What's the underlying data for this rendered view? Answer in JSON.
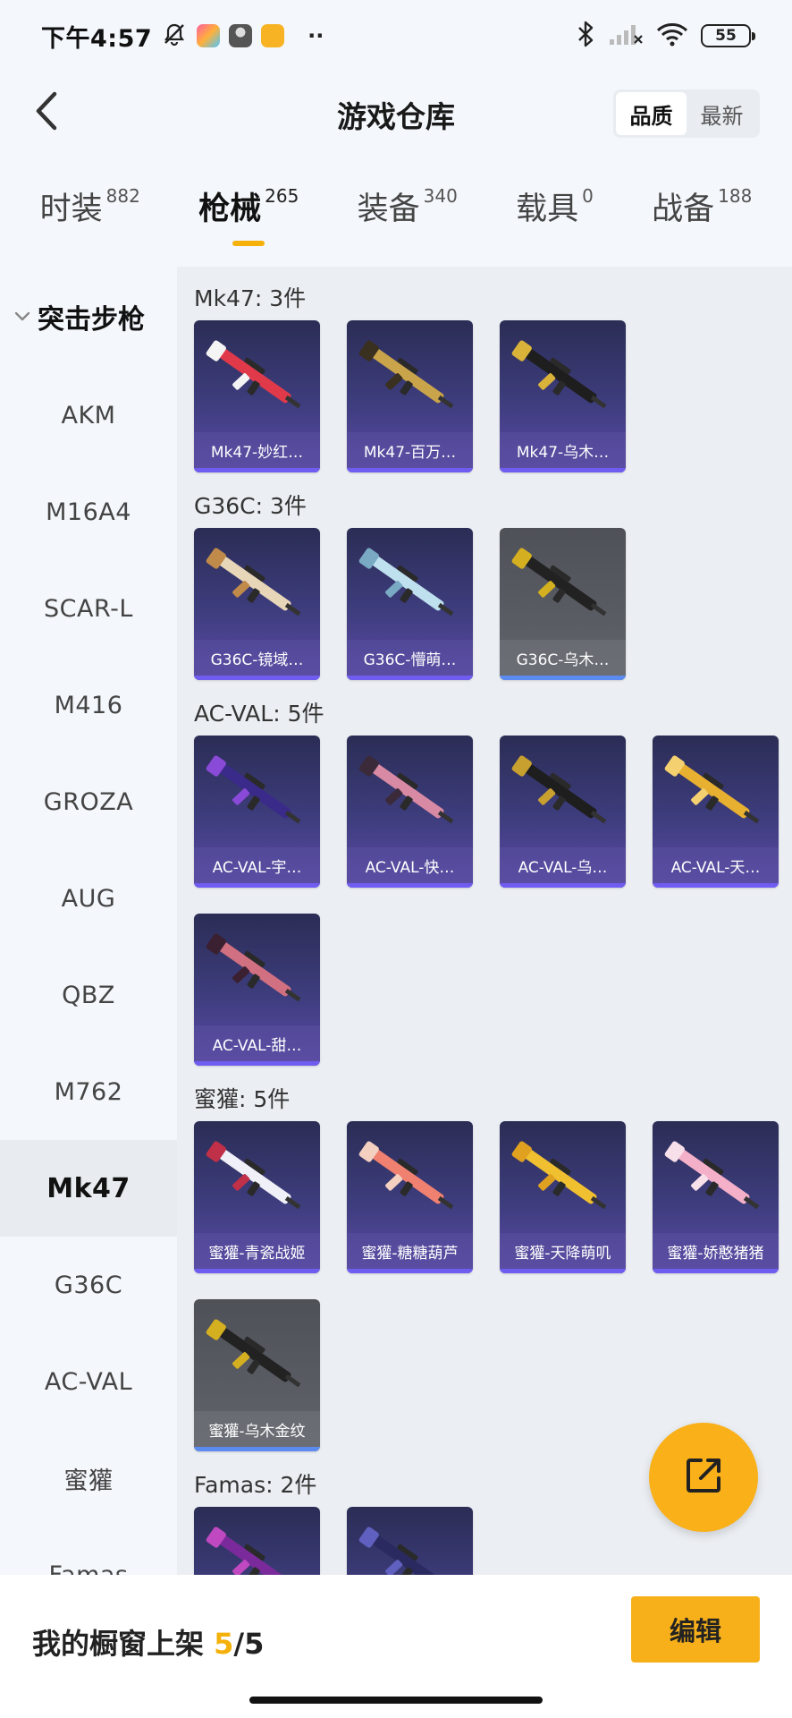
{
  "status_bar": {
    "time": "下午4:57",
    "battery": "55",
    "icons": [
      "mute-bell-icon",
      "game-app-icon",
      "avatar-app-icon",
      "note-app-icon",
      "more-dots-icon",
      "bluetooth-icon",
      "signal-icon",
      "wifi-icon",
      "battery-icon"
    ]
  },
  "header": {
    "title": "游戏仓库",
    "sort_options": [
      "品质",
      "最新"
    ],
    "active_sort": "品质"
  },
  "tabs": [
    {
      "label": "时装",
      "count": "882"
    },
    {
      "label": "枪械",
      "count": "265"
    },
    {
      "label": "装备",
      "count": "340"
    },
    {
      "label": "载具",
      "count": "0"
    },
    {
      "label": "战备",
      "count": "188"
    }
  ],
  "active_tab": "枪械",
  "sidebar": {
    "group": "突击步枪",
    "items": [
      "AKM",
      "M16A4",
      "SCAR-L",
      "M416",
      "GROZA",
      "AUG",
      "QBZ",
      "M762",
      "Mk47",
      "G36C",
      "AC-VAL",
      "蜜獾",
      "Famas"
    ],
    "active": "Mk47"
  },
  "sections": [
    {
      "title": "Mk47: 3件",
      "items": [
        {
          "name": "Mk47-妙红…",
          "grade": "purple"
        },
        {
          "name": "Mk47-百万…",
          "grade": "purple"
        },
        {
          "name": "Mk47-乌木…",
          "grade": "purple"
        }
      ]
    },
    {
      "title": "G36C: 3件",
      "items": [
        {
          "name": "G36C-镜域…",
          "grade": "purple"
        },
        {
          "name": "G36C-懵萌…",
          "grade": "purple"
        },
        {
          "name": "G36C-乌木…",
          "grade": "grey"
        }
      ]
    },
    {
      "title": "AC-VAL: 5件",
      "items": [
        {
          "name": "AC-VAL-宇…",
          "grade": "purple"
        },
        {
          "name": "AC-VAL-快…",
          "grade": "purple"
        },
        {
          "name": "AC-VAL-乌…",
          "grade": "purple"
        },
        {
          "name": "AC-VAL-天…",
          "grade": "purple"
        },
        {
          "name": "AC-VAL-甜…",
          "grade": "purple"
        }
      ]
    },
    {
      "title": "蜜獾: 5件",
      "items": [
        {
          "name": "蜜獾-青瓷战姬",
          "grade": "purple"
        },
        {
          "name": "蜜獾-糖糖葫芦",
          "grade": "purple"
        },
        {
          "name": "蜜獾-天降萌叽",
          "grade": "purple"
        },
        {
          "name": "蜜獾-娇憨猪猪",
          "grade": "purple"
        },
        {
          "name": "蜜獾-乌木金纹",
          "grade": "grey"
        }
      ]
    },
    {
      "title": "Famas: 2件",
      "items": [
        {
          "name": "",
          "grade": "purple"
        },
        {
          "name": "",
          "grade": "purple"
        }
      ]
    }
  ],
  "footer": {
    "shelf_label": "我的橱窗上架",
    "shelf_count": "5",
    "shelf_total": "/5",
    "edit_label": "编辑"
  },
  "colors": {
    "accent": "#f5b10a",
    "card_purple": "#3e3d7e",
    "card_grey": "#5c5e66"
  }
}
